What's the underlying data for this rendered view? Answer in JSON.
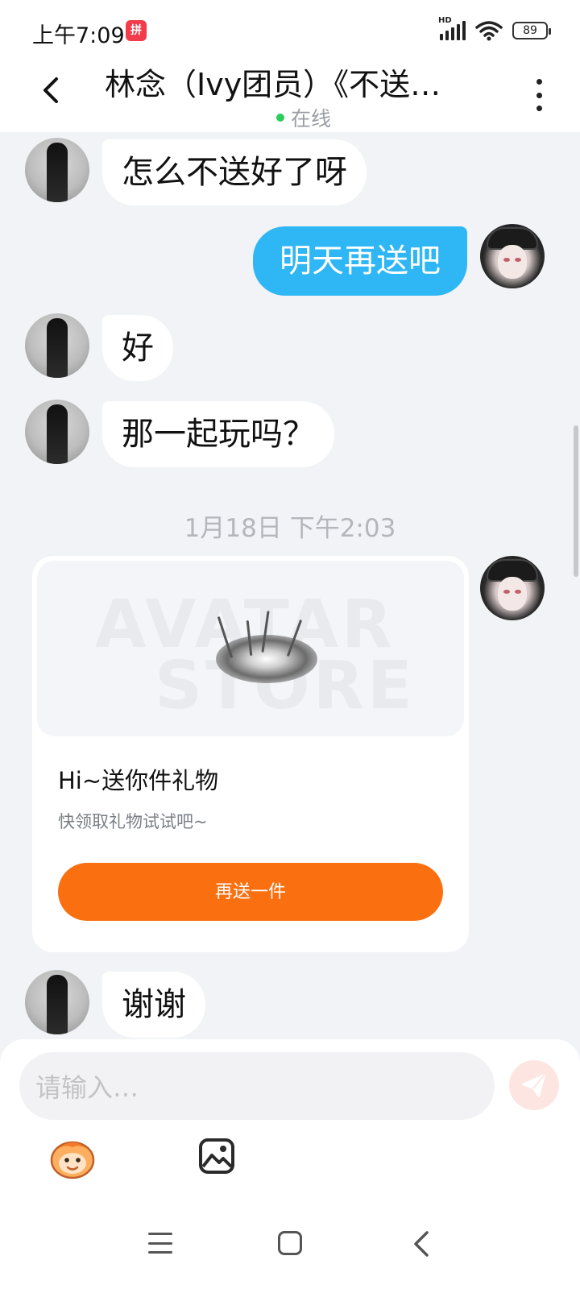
{
  "status_bar": {
    "time": "上午7:09",
    "app_icon_text": "拼",
    "signal_label": "HD",
    "battery": "89"
  },
  "header": {
    "title": "林念（Ivy团员）《不送…",
    "status": "在线"
  },
  "messages": [
    {
      "side": "in",
      "text": "怎么不送好了呀"
    },
    {
      "side": "out",
      "text": "明天再送吧"
    },
    {
      "side": "in",
      "text": "好"
    },
    {
      "side": "in",
      "text": "那一起玩吗？"
    }
  ],
  "timestamp": "1月18日 下午2:03",
  "gift_card": {
    "watermark_top": "AVATAR",
    "watermark_bottom": "STORE",
    "title": "Hi~送你件礼物",
    "description": "快领取礼物试试吧~",
    "button_label": "再送一件"
  },
  "last_message": {
    "side": "in",
    "text": "谢谢"
  },
  "composer": {
    "placeholder": "请输入…"
  },
  "colors": {
    "outgoing_bubble": "#2fb6f5",
    "gift_button": "#fa6f0f",
    "online": "#2ecc5a",
    "background": "#f1f3f6"
  }
}
